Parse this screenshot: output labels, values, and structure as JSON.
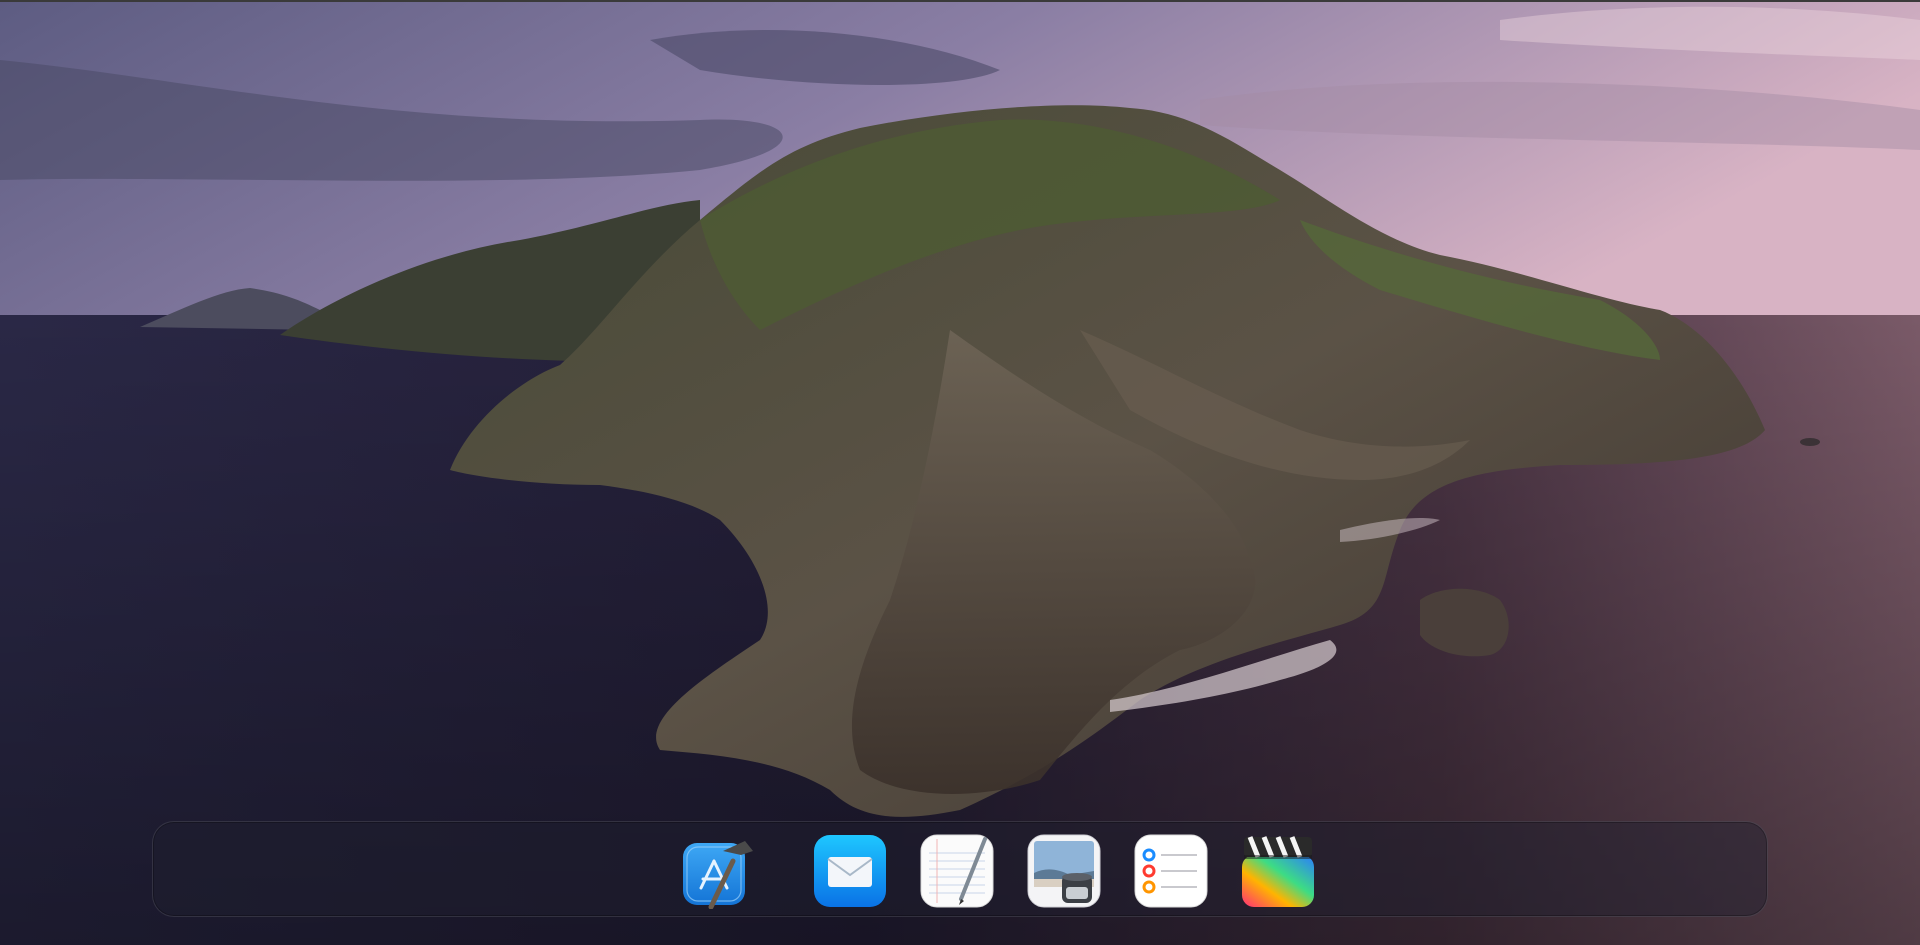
{
  "desktop": {
    "wallpaper": "macos-catalina-island",
    "colors": {
      "sky_top": "#6b6a8f",
      "sky_horizon": "#c9a4b8",
      "sea_left": "#2a2846",
      "sea_right": "#6a4a58",
      "rock": "#5a5048",
      "grass": "#4d5a34"
    }
  },
  "dock": {
    "apps": [
      {
        "id": "xcode",
        "label": "Xcode",
        "icon": "xcode-icon"
      },
      {
        "id": "mail",
        "label": "Mail",
        "icon": "mail-icon"
      },
      {
        "id": "textedit",
        "label": "TextEdit",
        "icon": "textedit-icon"
      },
      {
        "id": "preview",
        "label": "Preview",
        "icon": "preview-icon"
      },
      {
        "id": "reminders",
        "label": "Reminders",
        "icon": "reminders-icon"
      },
      {
        "id": "final-cut-pro",
        "label": "Final Cut Pro",
        "icon": "final-cut-pro-icon"
      }
    ]
  }
}
